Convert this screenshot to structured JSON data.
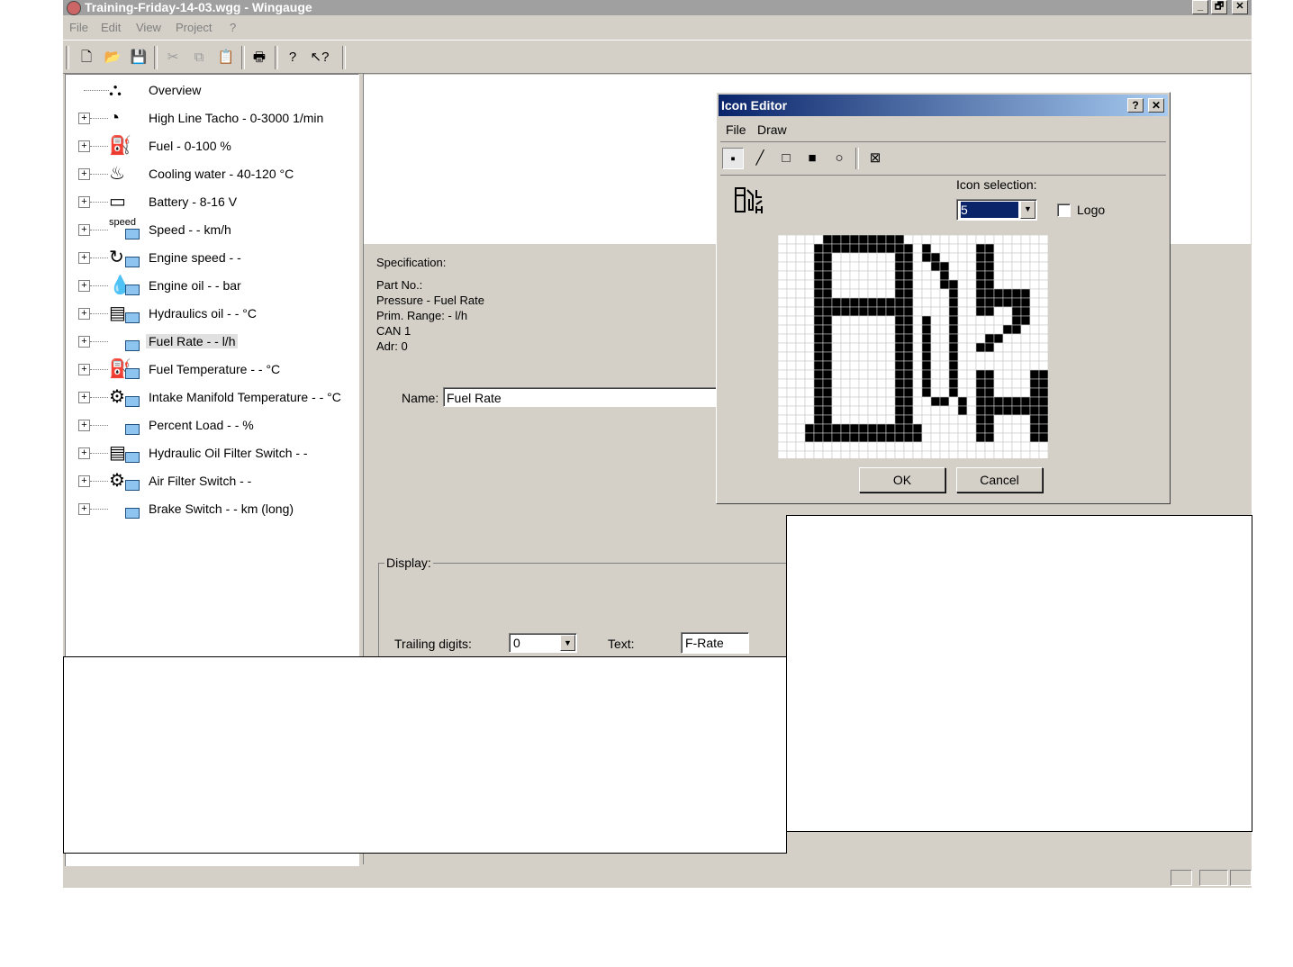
{
  "window": {
    "title": "Training-Friday-14-03.wgg - Wingauge",
    "minimize": "_",
    "restore": "🗗",
    "close": "✕"
  },
  "menu": [
    "File",
    "Edit",
    "View",
    "Project",
    "?"
  ],
  "toolbar": {
    "icons": [
      "new-file-icon",
      "open-folder-icon",
      "save-icon",
      "cut-icon",
      "copy-icon",
      "paste-icon",
      "print-icon",
      "help-icon",
      "context-help-icon"
    ]
  },
  "tree": {
    "items": [
      {
        "label": "Overview",
        "icon": "overview-icon"
      },
      {
        "label": "High Line Tacho - 0-3000 1/min",
        "icon": "tacho-icon"
      },
      {
        "label": "Fuel - 0-100 %",
        "icon": "fuel-icon"
      },
      {
        "label": "Cooling water - 40-120 °C",
        "icon": "cooling-water-icon"
      },
      {
        "label": "Battery - 8-16 V",
        "icon": "battery-icon"
      },
      {
        "label": "Speed - - km/h",
        "icon": "speed-icon",
        "icon_text": "speed"
      },
      {
        "label": "Engine speed - -",
        "icon": "engine-speed-icon"
      },
      {
        "label": "Engine oil - - bar",
        "icon": "engine-oil-icon"
      },
      {
        "label": "Hydraulics oil - - °C",
        "icon": "hydraulics-oil-icon"
      },
      {
        "label": "Fuel Rate - - l/h",
        "icon": "fuel-rate-icon",
        "selected": true
      },
      {
        "label": "Fuel Temperature - - °C",
        "icon": "fuel-temperature-icon"
      },
      {
        "label": "Intake Manifold Temperature - - °C",
        "icon": "intake-manifold-icon"
      },
      {
        "label": "Percent Load - - %",
        "icon": "percent-load-icon"
      },
      {
        "label": "Hydraulic Oil Filter Switch - -",
        "icon": "hydraulic-filter-icon"
      },
      {
        "label": "Air Filter Switch - -",
        "icon": "air-filter-icon"
      },
      {
        "label": "Brake Switch - - km (long)",
        "icon": "brake-switch-icon"
      }
    ]
  },
  "spec": {
    "heading": "Specification:",
    "part_no": "Part No.:",
    "pressure": "Pressure - Fuel Rate",
    "range": "Prim. Range: - l/h",
    "can": "CAN 1",
    "adr": "Adr: 0"
  },
  "name_field": {
    "label": "Name:",
    "value": "Fuel Rate"
  },
  "display": {
    "group_label": "Display:",
    "trailing_label": "Trailing digits:",
    "trailing_value": "0",
    "text_label": "Text:",
    "text_value": "F-Rate"
  },
  "icon_editor": {
    "title": "Icon Editor",
    "help": "?",
    "close": "✕",
    "menu": [
      "File",
      "Draw"
    ],
    "tools": [
      "point-tool-icon",
      "line-tool-icon",
      "rect-tool-icon",
      "filled-rect-tool-icon",
      "circle-tool-icon",
      "clear-tool-icon"
    ],
    "selection_label": "Icon selection:",
    "selection_value": "5",
    "logo_label": "Logo",
    "logo_checked": false,
    "ok": "OK",
    "cancel": "Cancel",
    "grid_cols": 30,
    "grid_rows": 25
  }
}
